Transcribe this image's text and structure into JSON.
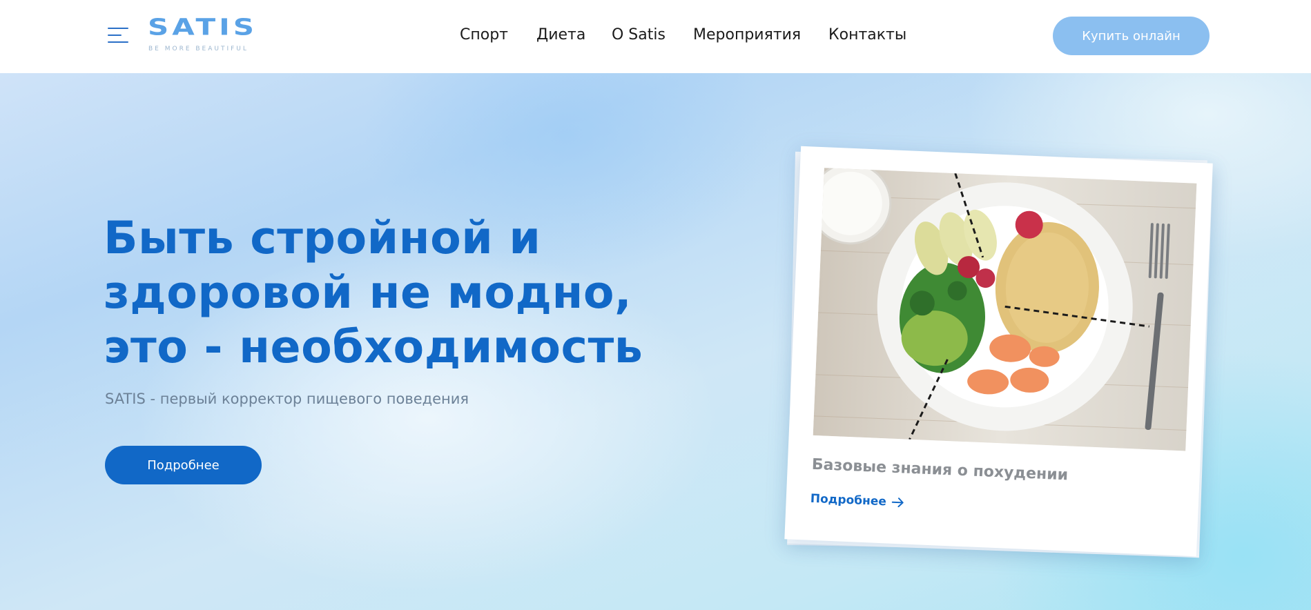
{
  "header": {
    "logo": {
      "word": "SATIS",
      "tagline": "BE MORE BEAUTIFUL"
    },
    "nav": [
      {
        "label": "Спорт"
      },
      {
        "label": "Диета"
      },
      {
        "label": "О Satis"
      },
      {
        "label": "Мероприятия"
      },
      {
        "label": "Контакты"
      }
    ],
    "buy_button": "Купить онлайн"
  },
  "hero": {
    "headline_lines": [
      "Быть стройной и",
      "здоровой не модно,",
      "это - необходимость"
    ],
    "subtitle": "SATIS - первый корректор пищевого поведения",
    "more_button": "Подробнее"
  },
  "card": {
    "title": "Базовые знания о похудении",
    "link": "Подробнее",
    "icon": "arrow-right-icon"
  },
  "colors": {
    "brand_blue": "#1168c7",
    "logo_blue": "#5aa2e6",
    "buy_button_bg": "#8bbff0",
    "subtitle_gray": "#6c8197",
    "card_title_gray": "#8b8f94"
  }
}
